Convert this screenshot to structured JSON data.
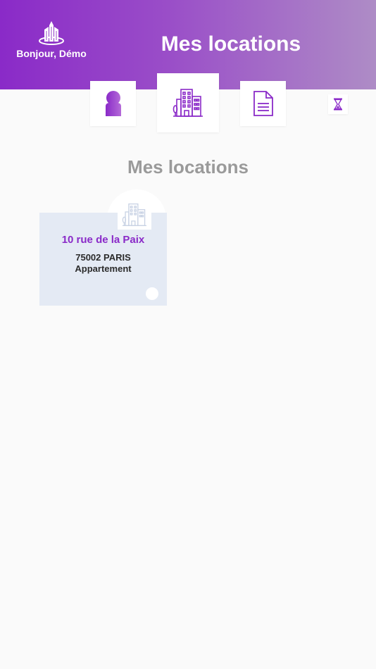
{
  "header": {
    "greeting": "Bonjour, Démo",
    "title": "Mes locations"
  },
  "nav": {
    "items": [
      {
        "icon": "user-icon"
      },
      {
        "icon": "buildings-icon",
        "active": true
      },
      {
        "icon": "document-icon"
      },
      {
        "icon": "hourglass-icon"
      }
    ]
  },
  "main": {
    "section_title": "Mes locations",
    "rentals": [
      {
        "address": "10 rue de la Paix",
        "city": "75002 PARIS",
        "type": "Appartement"
      }
    ]
  },
  "colors": {
    "brand": "#8a2ac8",
    "header_gradient_end": "#ae8cc6",
    "card_background": "#e4eaf4",
    "section_title": "#9a9a9a"
  }
}
